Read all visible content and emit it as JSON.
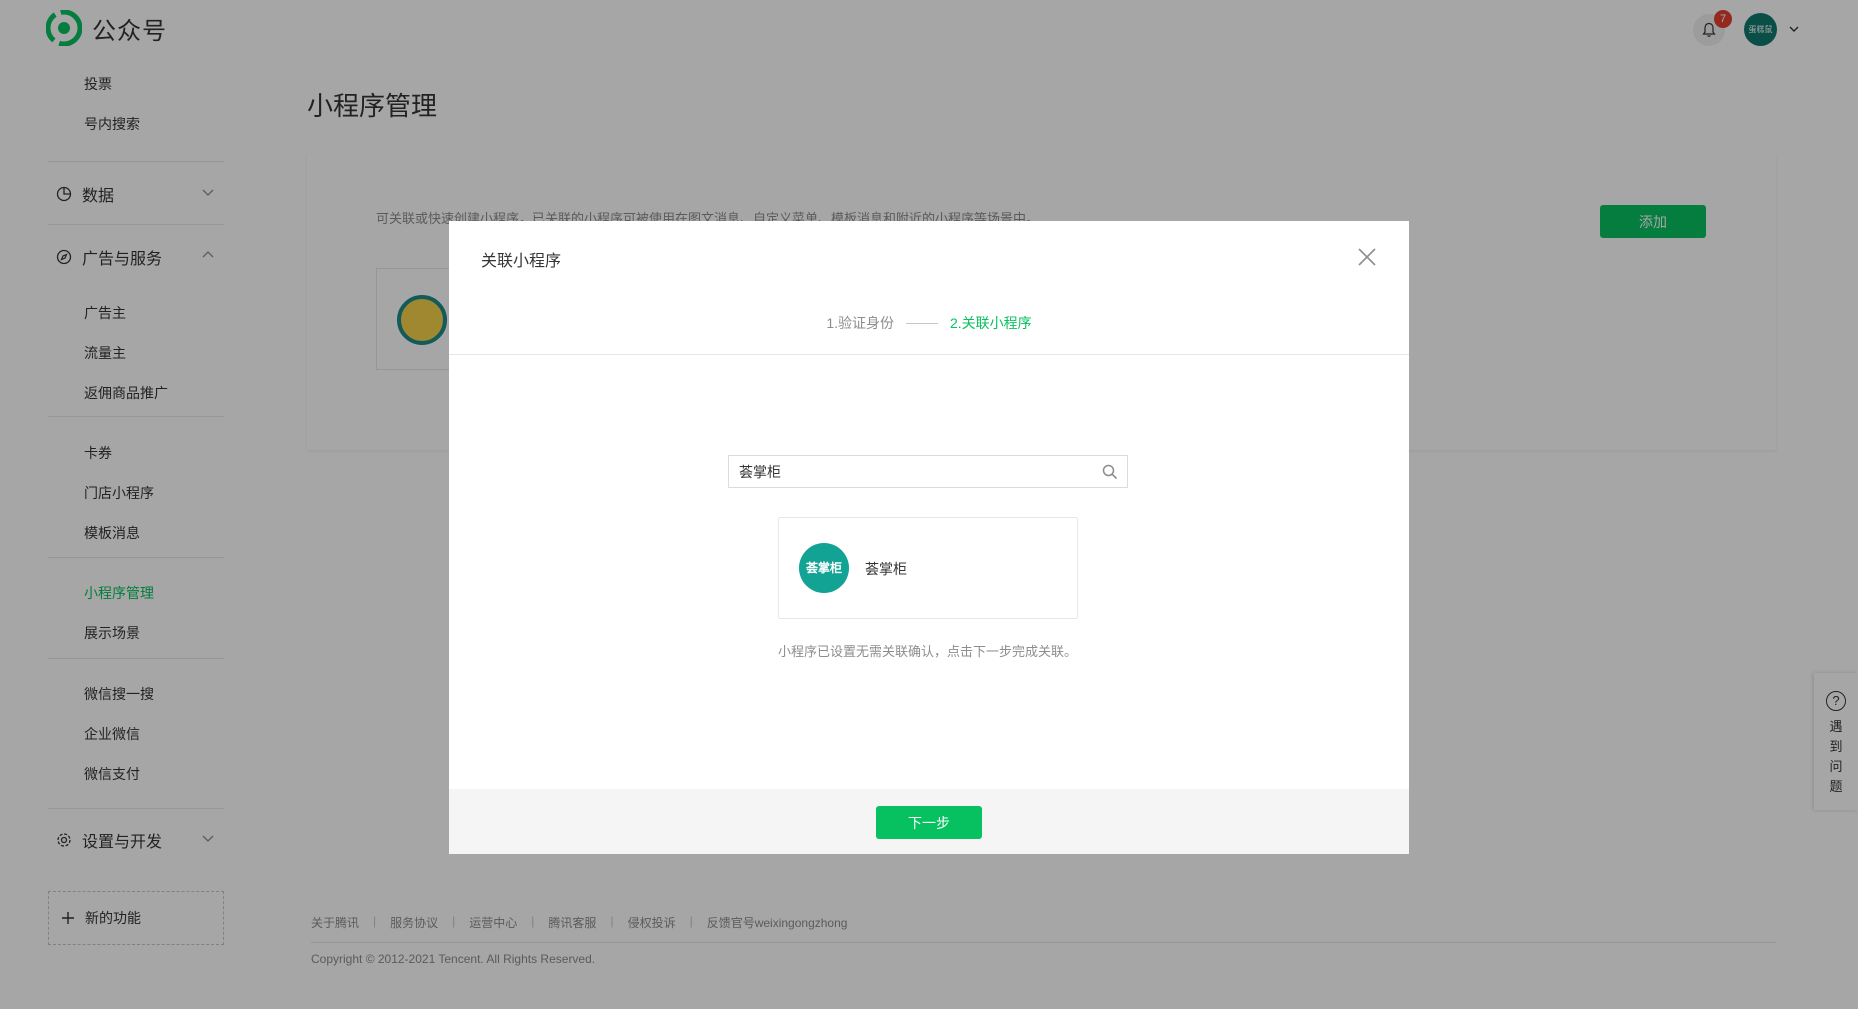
{
  "header": {
    "app_name": "公众号",
    "notification_count": "7",
    "avatar_text": "蛋糕鼠"
  },
  "sidebar": {
    "items_top": [
      "投票",
      "号内搜索"
    ],
    "data_label": "数据",
    "ads_label": "广告与服务",
    "ads_items": [
      "广告主",
      "流量主",
      "返佣商品推广"
    ],
    "group2": [
      "卡券",
      "门店小程序",
      "模板消息"
    ],
    "group3": [
      "小程序管理",
      "展示场景"
    ],
    "group4": [
      "微信搜一搜",
      "企业微信",
      "微信支付"
    ],
    "settings_label": "设置与开发",
    "new_func_label": "新的功能",
    "active_item": "小程序管理"
  },
  "main": {
    "page_title": "小程序管理",
    "description": "可关联或快速创建小程序，已关联的小程序可被使用在图文消息、自定义菜单、模板消息和附近的小程序等场景中。",
    "add_label": "添加"
  },
  "dialog": {
    "title": "关联小程序",
    "step1": "1.验证身份",
    "step2": "2.关联小程序",
    "search_value": "荟掌柜",
    "result_name": "荟掌柜",
    "result_logo_text": "荟掌柜",
    "tip": "小程序已设置无需关联确认，点击下一步完成关联。",
    "next_label": "下一步"
  },
  "footer": {
    "links": [
      "关于腾讯",
      "服务协议",
      "运营中心",
      "腾讯客服",
      "侵权投诉",
      "反馈官号weixingongzhong"
    ],
    "copyright": "Copyright © 2012-2021 Tencent. All Rights Reserved."
  },
  "help": {
    "label": "遇到问题"
  },
  "colors": {
    "brand_green": "#07c160",
    "badge_red": "#e2412d",
    "overlay": "rgba(0,0,0,0.35)"
  }
}
